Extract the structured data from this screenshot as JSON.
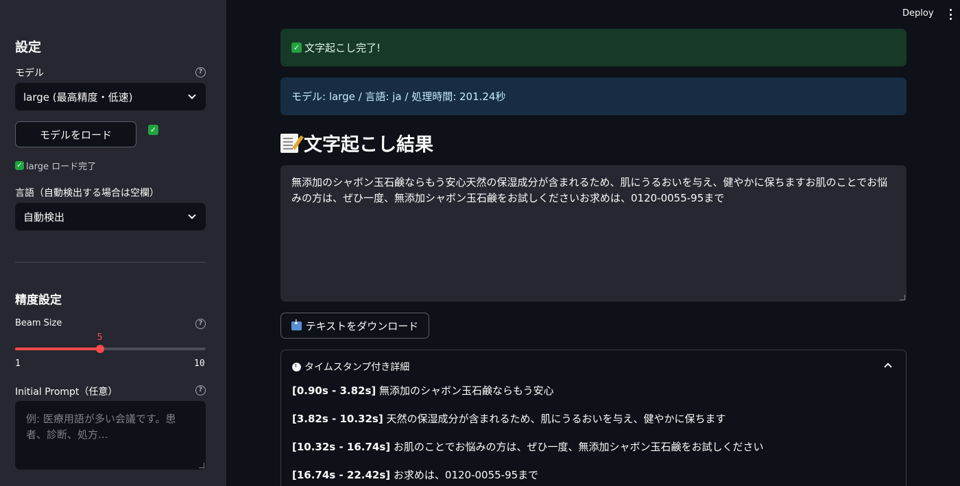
{
  "sidebar": {
    "title": "設定",
    "model_label": "モデル",
    "model_selected": "large (最高精度・低速)",
    "load_button": "モデルをロード",
    "load_status_icon": "✓",
    "load_status": "large ロード完了",
    "language_label": "言語（自動検出する場合は空欄）",
    "language_selected": "自動検出",
    "precision_title": "精度設定",
    "beam_label": "Beam Size",
    "beam": {
      "value": 5,
      "min": 1,
      "max": 10,
      "value_label": "5",
      "min_label": "1",
      "max_label": "10"
    },
    "prompt_label": "Initial Prompt（任意）",
    "prompt_placeholder": "例: 医療用語が多い会議です。患者、診断、処方...",
    "help_glyph": "?"
  },
  "header": {
    "deploy": "Deploy"
  },
  "main": {
    "success_msg": "文字起こし完了!",
    "info_msg": "モデル: large / 言語: ja / 処理時間: 201.24秒",
    "section_title": "文字起こし結果",
    "result_text": "無添加のシャボン玉石鹸ならもう安心天然の保湿成分が含まれるため、肌にうるおいを与え、健やかに保ちますお肌のことでお悩みの方は、ぜひ一度、無添加シャボン玉石鹸をお試しくださいお求めは、0120-0055-95まで",
    "download_button": "テキストをダウンロード",
    "timestamps_title": "タイムスタンプ付き詳細",
    "segments": [
      {
        "time": "[0.90s - 3.82s]",
        "text": "無添加のシャボン玉石鹸ならもう安心"
      },
      {
        "time": "[3.82s - 10.32s]",
        "text": "天然の保湿成分が含まれるため、肌にうるおいを与え、健やかに保ちます"
      },
      {
        "time": "[10.32s - 16.74s]",
        "text": "お肌のことでお悩みの方は、ぜひ一度、無添加シャボン玉石鹸をお試しください"
      },
      {
        "time": "[16.74s - 22.42s]",
        "text": "お求めは、0120-0055-95まで"
      }
    ]
  },
  "colors": {
    "accent": "#ff4b4b",
    "success_bg": "#173928",
    "info_bg": "#172d43",
    "sidebar_bg": "#262730",
    "main_bg": "#0e1117"
  },
  "icons": {
    "check": "check-icon",
    "memo": "memo-icon",
    "tray": "inbox-tray-icon",
    "clock": "clock-icon"
  }
}
